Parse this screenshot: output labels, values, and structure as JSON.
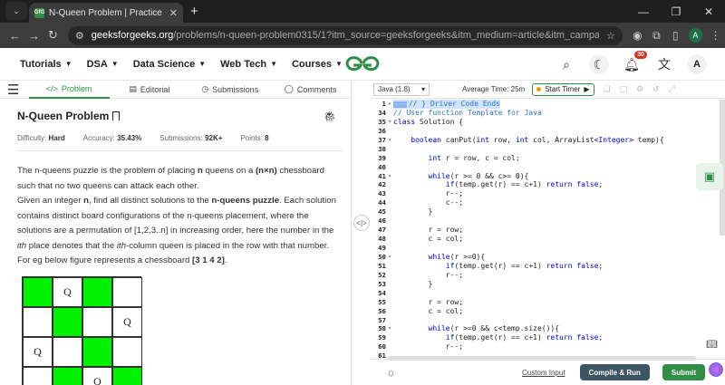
{
  "browser": {
    "tab_title": "N-Queen Problem | Practice | G",
    "tab_favicon": "GfG",
    "url_domain": "geeksforgeeks.org",
    "url_path": "/problems/n-queen-problem0315/1?itm_source=geeksforgeeks&itm_medium=article&itm_campaign=practice_card",
    "profile_initial": "A"
  },
  "header": {
    "nav": [
      "Tutorials",
      "DSA",
      "Data Science",
      "Web Tech",
      "Courses"
    ],
    "notif_count": "30",
    "avatar": "A",
    "brand_color": "#2f8d46"
  },
  "left": {
    "tabs": [
      "Problem",
      "Editorial",
      "Submissions",
      "Comments"
    ],
    "title": "N-Queen Problem",
    "difficulty_label": "Difficulty:",
    "difficulty": "Hard",
    "accuracy_label": "Accuracy:",
    "accuracy": "35.43%",
    "submissions_label": "Submissions:",
    "submissions": "92K+",
    "points_label": "Points:",
    "points": "8",
    "p1_a": "The n-queens puzzle is the problem of placing ",
    "p1_b": "n",
    "p1_c": " queens on a ",
    "p1_d": "(n×n)",
    "p1_e": " chessboard such that no two queens can attack each other.",
    "p2_a": "Given an integer ",
    "p2_b": "n",
    "p2_c": ", find all distinct solutions to the ",
    "p2_d": "n-queens puzzle",
    "p2_e": ". Each solution contains distinct board configurations of the n-queens placement, where the solutions are a permutation of [1,2,3..n] in increasing order, here the number in the ",
    "p2_f": "ith",
    "p2_g": " place denotes that the ",
    "p2_h": "ith",
    "p2_i": "-column queen is placed in the row with that number.",
    "p3_a": "For eg below figure represents a chessboard ",
    "p3_b": "[3 1 4 2]",
    "p3_c": ".",
    "board": [
      [
        "g",
        "q",
        "g",
        "w"
      ],
      [
        "w",
        "g",
        "w",
        "q"
      ],
      [
        "q",
        "w",
        "g",
        "w"
      ],
      [
        "w",
        "g",
        "q",
        "g"
      ]
    ],
    "queen_char": "Q"
  },
  "editor": {
    "language": "Java (1.8)",
    "avg_time_label": "Average Time: 25m",
    "timer_label": "Start Timer",
    "custom_input": "Custom Input",
    "run": "Compile & Run",
    "submit": "Submit"
  },
  "code": [
    {
      "n": "1",
      "f": "▸",
      "t": "// } Driver Code Ends",
      "c": "cm",
      "hl": true
    },
    {
      "n": "34",
      "f": "",
      "t": "// User function Template for Java",
      "c": "cm"
    },
    {
      "n": "35",
      "f": "▾",
      "t": "class Solution {",
      "c": ""
    },
    {
      "n": "36",
      "f": "",
      "t": "",
      "c": ""
    },
    {
      "n": "37",
      "f": "▾",
      "t": "    boolean canPut(int row, int col, ArrayList<Integer> temp){",
      "c": ""
    },
    {
      "n": "38",
      "f": "",
      "t": "",
      "c": ""
    },
    {
      "n": "39",
      "f": "",
      "t": "        int r = row, c = col;",
      "c": ""
    },
    {
      "n": "40",
      "f": "",
      "t": "",
      "c": ""
    },
    {
      "n": "41",
      "f": "▾",
      "t": "        while(r >= 0 && c>= 0){",
      "c": ""
    },
    {
      "n": "42",
      "f": "",
      "t": "            if(temp.get(r) == c+1) return false;",
      "c": ""
    },
    {
      "n": "43",
      "f": "",
      "t": "            r--;",
      "c": ""
    },
    {
      "n": "44",
      "f": "",
      "t": "            c--;",
      "c": ""
    },
    {
      "n": "45",
      "f": "",
      "t": "        }",
      "c": ""
    },
    {
      "n": "46",
      "f": "",
      "t": "",
      "c": ""
    },
    {
      "n": "47",
      "f": "",
      "t": "        r = row;",
      "c": ""
    },
    {
      "n": "48",
      "f": "",
      "t": "        c = col;",
      "c": ""
    },
    {
      "n": "49",
      "f": "",
      "t": "",
      "c": ""
    },
    {
      "n": "50",
      "f": "▾",
      "t": "        while(r >=0){",
      "c": ""
    },
    {
      "n": "51",
      "f": "",
      "t": "            if(temp.get(r) == c+1) return false;",
      "c": ""
    },
    {
      "n": "52",
      "f": "",
      "t": "            r--;",
      "c": ""
    },
    {
      "n": "53",
      "f": "",
      "t": "        }",
      "c": ""
    },
    {
      "n": "54",
      "f": "",
      "t": "",
      "c": ""
    },
    {
      "n": "55",
      "f": "",
      "t": "        r = row;",
      "c": ""
    },
    {
      "n": "56",
      "f": "",
      "t": "        c = col;",
      "c": ""
    },
    {
      "n": "57",
      "f": "",
      "t": "",
      "c": ""
    },
    {
      "n": "58",
      "f": "▾",
      "t": "        while(r >=0 && c<temp.size()){",
      "c": ""
    },
    {
      "n": "59",
      "f": "",
      "t": "            if(temp.get(r) == c+1) return false;",
      "c": ""
    },
    {
      "n": "60",
      "f": "",
      "t": "            r--;",
      "c": ""
    },
    {
      "n": "61",
      "f": "",
      "t": "",
      "c": ""
    }
  ]
}
